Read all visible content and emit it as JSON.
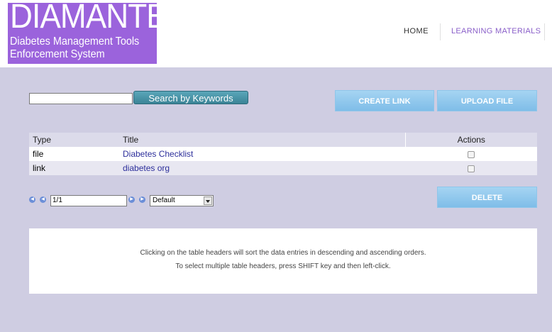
{
  "logo": {
    "title": "DIAMANTES",
    "subtitle_line1": "Diabetes Management Tools",
    "subtitle_line2": "Enforcement System"
  },
  "nav": {
    "home": "HOME",
    "learning": "LEARNING MATERIALS"
  },
  "search": {
    "value": "",
    "button": "Search by Keywords"
  },
  "buttons": {
    "create_link": "CREATE LINK",
    "upload_file": "UPLOAD FILE",
    "delete": "DELETE"
  },
  "table": {
    "headers": {
      "type": "Type",
      "title": "Title",
      "actions": "Actions"
    },
    "rows": [
      {
        "type": "file",
        "title": "Diabetes Checklist",
        "checked": false
      },
      {
        "type": "link",
        "title": "diabetes org",
        "checked": false
      }
    ]
  },
  "pager": {
    "page": "1/1",
    "sort": "Default"
  },
  "info": {
    "line1": "Clicking on the table headers will sort the data entries in descending and ascending orders.",
    "line2": "To select multiple table headers, press SHIFT key and then left-click."
  },
  "icons": [
    "first-page-icon",
    "prev-page-icon",
    "next-page-icon",
    "last-page-icon",
    "dropdown-arrow-icon",
    "checkbox-icon"
  ],
  "colors": {
    "logo_bg": "#9b63dc",
    "content_bg": "#cfcde2",
    "accent_blue": "#7fbde8",
    "search_btn": "#3b8497",
    "link": "#2d2f9b"
  }
}
